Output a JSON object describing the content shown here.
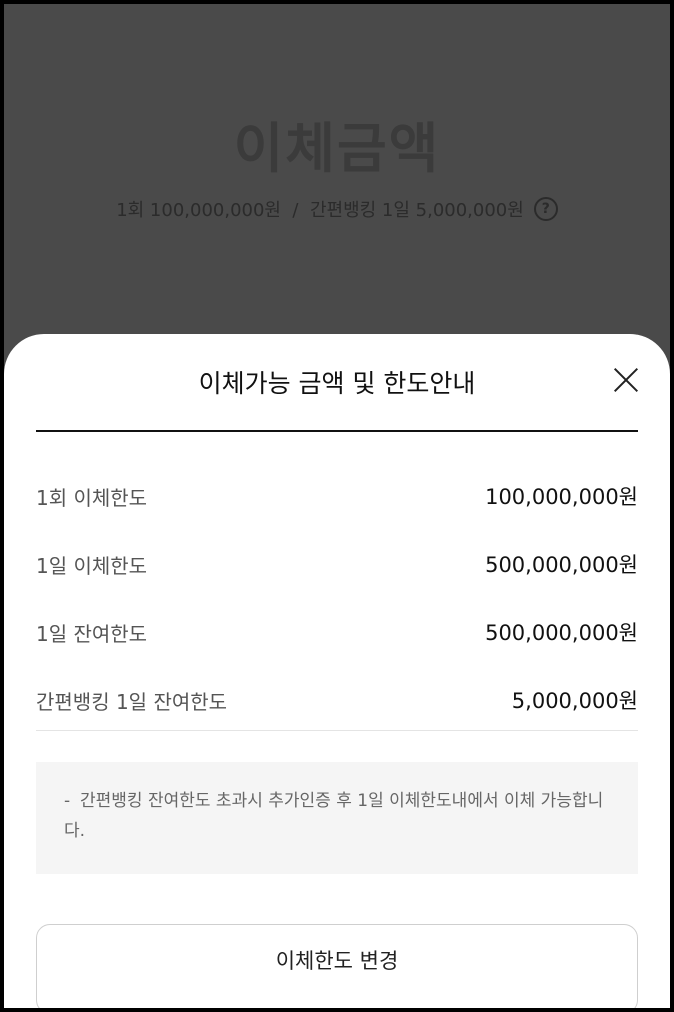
{
  "background": {
    "title": "이체금액",
    "subtitle": "1회 100,000,000원  /  간편뱅킹 1일 5,000,000원",
    "help_icon_glyph": "?"
  },
  "sheet": {
    "title": "이체가능 금액 및 한도안내",
    "rows": [
      {
        "label": "1회 이체한도",
        "value": "100,000,000원"
      },
      {
        "label": "1일 이체한도",
        "value": "500,000,000원"
      },
      {
        "label": "1일 잔여한도",
        "value": "500,000,000원"
      },
      {
        "label": "간편뱅킹 1일 잔여한도",
        "value": "5,000,000원"
      }
    ],
    "notice_dash": "-",
    "notice": "간편뱅킹 잔여한도 초과시 추가인증 후 1일 이체한도내에서 이체 가능합니다.",
    "change_button": "이체한도 변경"
  },
  "colors": {
    "dim_background": "#4a4a4a",
    "sheet_background": "#ffffff",
    "notice_background": "#f5f5f5"
  },
  "icons": [
    "help-icon",
    "close-icon"
  ]
}
